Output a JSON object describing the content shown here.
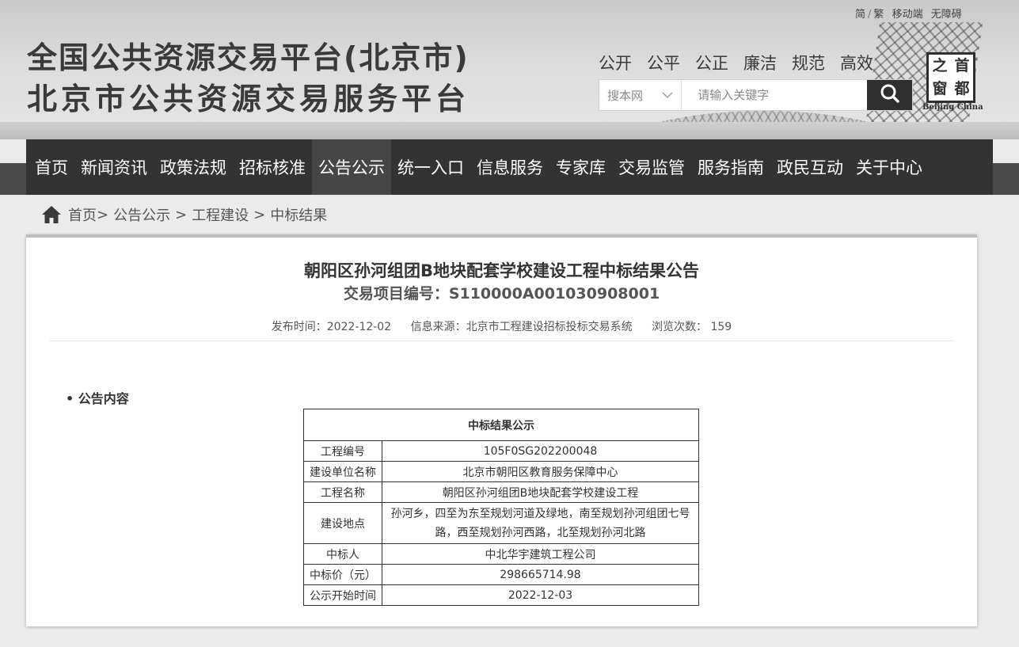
{
  "header": {
    "title_line1": "全国公共资源交易平台(北京市)",
    "title_line2": "北京市公共资源交易服务平台",
    "top_links": [
      "简",
      "繁",
      "移动端",
      "无障碍"
    ],
    "values": [
      "公开",
      "公平",
      "公正",
      "廉洁",
      "规范",
      "高效"
    ],
    "search": {
      "scope": "搜本网",
      "placeholder": "请输入关键字"
    },
    "seal": {
      "chars": [
        "之",
        "首",
        "窗",
        "都"
      ],
      "en": "Beijing China"
    }
  },
  "nav": {
    "items": [
      "首页",
      "新闻资讯",
      "政策法规",
      "招标核准",
      "公告公示",
      "统一入口",
      "信息服务",
      "专家库",
      "交易监管",
      "服务指南",
      "政民互动",
      "关于中心"
    ],
    "active": "公告公示"
  },
  "breadcrumb": {
    "items": [
      "首页",
      "公告公示",
      "工程建设",
      "中标结果"
    ]
  },
  "article": {
    "title": "朝阳区孙河组团B地块配套学校建设工程中标结果公告",
    "project_no": "交易项目编号：S110000A001030908001",
    "publish_time": "发布时间：2022-12-02",
    "source": "信息来源：北京市工程建设招标投标交易系统",
    "views": "浏览次数：  159",
    "section_label": "• 公告内容",
    "table": {
      "title": "中标结果公示",
      "rows": [
        {
          "key": "工程编号",
          "value": "105F0SG202200048"
        },
        {
          "key": "建设单位名称",
          "value": "北京市朝阳区教育服务保障中心"
        },
        {
          "key": "工程名称",
          "value": "朝阳区孙河组团B地块配套学校建设工程"
        },
        {
          "key": "建设地点",
          "value": "孙河乡，四至为东至规划河道及绿地，南至规划孙河组团七号路，西至规划孙河西路，北至规划孙河北路"
        },
        {
          "key": "中标人",
          "value": "中北华宇建筑工程公司"
        },
        {
          "key": "中标价（元）",
          "value": "298665714.98"
        },
        {
          "key": "公示开始时间",
          "value": "2022-12-03"
        }
      ]
    }
  }
}
